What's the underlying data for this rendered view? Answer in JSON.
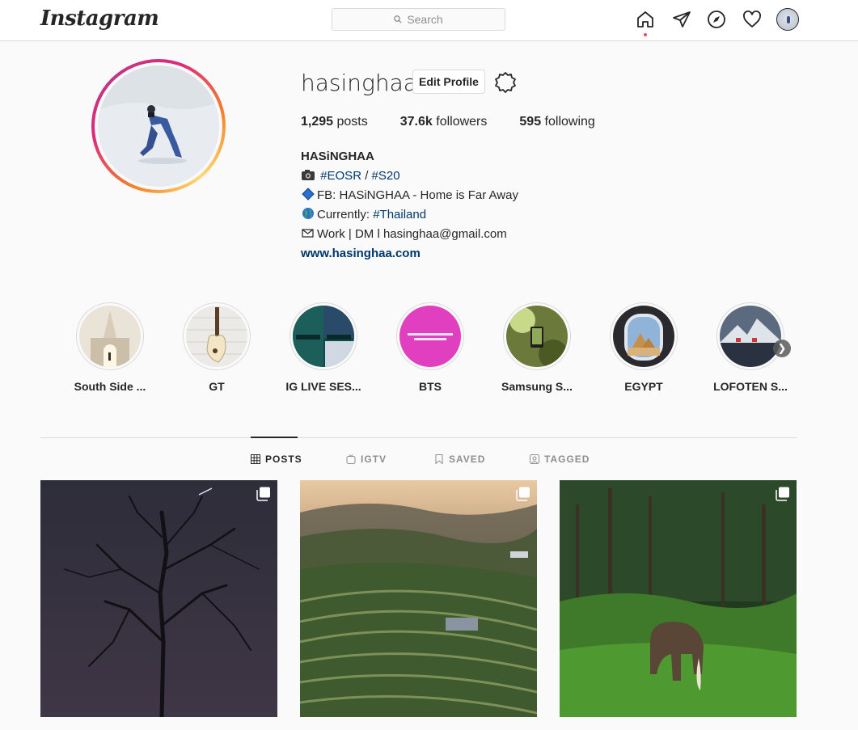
{
  "app": {
    "logo_text": "Instagram",
    "search_placeholder": "Search"
  },
  "nav": {
    "icons": [
      "home-icon",
      "direct-icon",
      "explore-icon",
      "activity-icon",
      "avatar"
    ]
  },
  "profile": {
    "username": "hasinghaa",
    "edit_button": "Edit Profile",
    "stats": {
      "posts_count": "1,295",
      "posts_label": "posts",
      "followers_count": "37.6k",
      "followers_label": "followers",
      "following_count": "595",
      "following_label": "following"
    },
    "bio": {
      "name": "HASiNGHAA",
      "line1_tag1": "#EOSR",
      "line1_sep": " / ",
      "line1_tag2": "#S20",
      "line2": "FB: HASiNGHAA - Home is Far Away",
      "line3_prefix": "Currently: ",
      "line3_tag": "#Thailand",
      "line4": "Work | DM l hasinghaa@gmail.com",
      "website": "www.hasinghaa.com"
    }
  },
  "highlights": [
    {
      "label": "South Side ..."
    },
    {
      "label": "GT"
    },
    {
      "label": "IG LIVE SES..."
    },
    {
      "label": "BTS"
    },
    {
      "label": "Samsung S..."
    },
    {
      "label": "EGYPT"
    },
    {
      "label": "LOFOTEN S..."
    }
  ],
  "tabs": [
    {
      "label": "POSTS",
      "active": true
    },
    {
      "label": "IGTV",
      "active": false
    },
    {
      "label": "SAVED",
      "active": false
    },
    {
      "label": "TAGGED",
      "active": false
    }
  ],
  "colors": {
    "link": "#00376b",
    "border": "#dbdbdb",
    "muted": "#8e8e8e",
    "notification": "#ed4956",
    "bts_highlight": "#e040c0"
  }
}
